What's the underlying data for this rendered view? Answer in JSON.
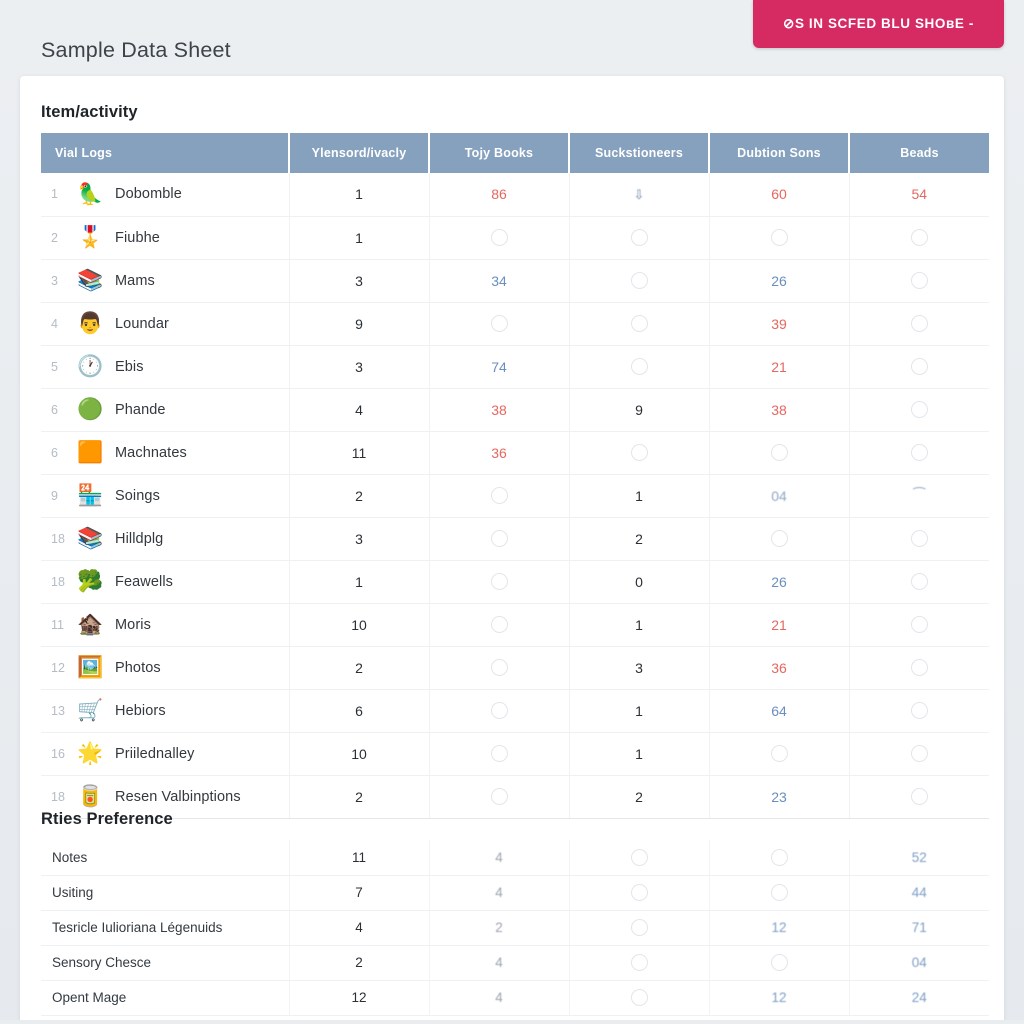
{
  "page": {
    "title": "Sample Data Sheet",
    "accent_pink": "#d62a63",
    "header_blue": "#86a1bd",
    "background": "#e9edf0"
  },
  "toolbar": {
    "action_label": "⊘S IN SCFED BLU SHOʙE -"
  },
  "section_main": {
    "title": "Item/activity",
    "columns": [
      "Vial Logs",
      "Ylensord/ivacly",
      "Tojy Books",
      "Suckstioneers",
      "Dubtion Sons",
      "Beads"
    ],
    "rows": [
      {
        "no": "1",
        "icon": "parrot-diving-icon",
        "glyph": "🦜",
        "name": "Dobomble",
        "c1": "1",
        "c2": "86",
        "c3": "⇩",
        "c4": "60",
        "c5": "54"
      },
      {
        "no": "2",
        "icon": "medal-seal-icon",
        "glyph": "🎖️",
        "name": "Fiubhe",
        "c1": "1",
        "c2": "○",
        "c3": "○",
        "c4": "○",
        "c5": "○"
      },
      {
        "no": "3",
        "icon": "books-stack-icon",
        "glyph": "📚",
        "name": "Mams",
        "c1": "3",
        "c2": "34",
        "c3": "○",
        "c4": "26",
        "c5": "○"
      },
      {
        "no": "4",
        "icon": "face-portrait-icon",
        "glyph": "👨",
        "name": "Loundar",
        "c1": "9",
        "c2": "○",
        "c3": "○",
        "c4": "39",
        "c5": "○"
      },
      {
        "no": "5",
        "icon": "clock-icon",
        "glyph": "🕐",
        "name": "Ebis",
        "c1": "3",
        "c2": "74",
        "c3": "○",
        "c4": "21",
        "c5": "○"
      },
      {
        "no": "6",
        "icon": "green-badge-icon",
        "glyph": "🟢",
        "name": "Phande",
        "c1": "4",
        "c2": "38",
        "c3": "9",
        "c4": "38",
        "c5": "○"
      },
      {
        "no": "6",
        "icon": "orange-bar-icon",
        "glyph": "🟧",
        "name": "Machnates",
        "c1": "11",
        "c2": "36",
        "c3": "○",
        "c4": "○",
        "c5": "○"
      },
      {
        "no": "9",
        "icon": "toy-shop-icon",
        "glyph": "🏪",
        "name": "Soings",
        "c1": "2",
        "c2": "○",
        "c3": "1",
        "c4": "04",
        "c5": "⁀"
      },
      {
        "no": "18",
        "icon": "books-stack-icon",
        "glyph": "📚",
        "name": "Hilldplg",
        "c1": "3",
        "c2": "○",
        "c3": "2",
        "c4": "○",
        "c5": "○"
      },
      {
        "no": "18",
        "icon": "broccoli-icon",
        "glyph": "🥦",
        "name": "Feawells",
        "c1": "1",
        "c2": "○",
        "c3": "0",
        "c4": "26",
        "c5": "○"
      },
      {
        "no": "11",
        "icon": "gingerbread-house-icon",
        "glyph": "🏚️",
        "name": "Moris",
        "c1": "10",
        "c2": "○",
        "c3": "1",
        "c4": "21",
        "c5": "○"
      },
      {
        "no": "12",
        "icon": "framed-picture-icon",
        "glyph": "🖼️",
        "name": "Photos",
        "c1": "2",
        "c2": "○",
        "c3": "3",
        "c4": "36",
        "c5": "○"
      },
      {
        "no": "13",
        "icon": "gift-cart-icon",
        "glyph": "🛒",
        "name": "Hebiors",
        "c1": "6",
        "c2": "○",
        "c3": "1",
        "c4": "64",
        "c5": "○"
      },
      {
        "no": "16",
        "icon": "star-icon",
        "glyph": "🌟",
        "name": "Priilednalley",
        "c1": "10",
        "c2": "○",
        "c3": "1",
        "c4": "○",
        "c5": "○"
      },
      {
        "no": "18",
        "icon": "thermos-can-icon",
        "glyph": "🥫",
        "name": "Resen Valbinptions",
        "c1": "2",
        "c2": "○",
        "c3": "2",
        "c4": "23",
        "c5": "○"
      }
    ]
  },
  "section_pref": {
    "title": "Rties Preference",
    "rows": [
      {
        "label": "Notes",
        "c1": "11",
        "c2": "4",
        "c3": "○",
        "c4": "○",
        "c5": "52"
      },
      {
        "label": "Usiting",
        "c1": "7",
        "c2": "4",
        "c3": "○",
        "c4": "○",
        "c5": "44"
      },
      {
        "label": "Tesricle Iulioriana Légenuids",
        "c1": "4",
        "c2": "2",
        "c3": "○",
        "c4": "12",
        "c5": "71"
      },
      {
        "label": "Sensory Chesce",
        "c1": "2",
        "c2": "4",
        "c3": "○",
        "c4": "○",
        "c5": "04"
      },
      {
        "label": "Opent Mage",
        "c1": "12",
        "c2": "4",
        "c3": "○",
        "c4": "12",
        "c5": "24"
      }
    ]
  }
}
